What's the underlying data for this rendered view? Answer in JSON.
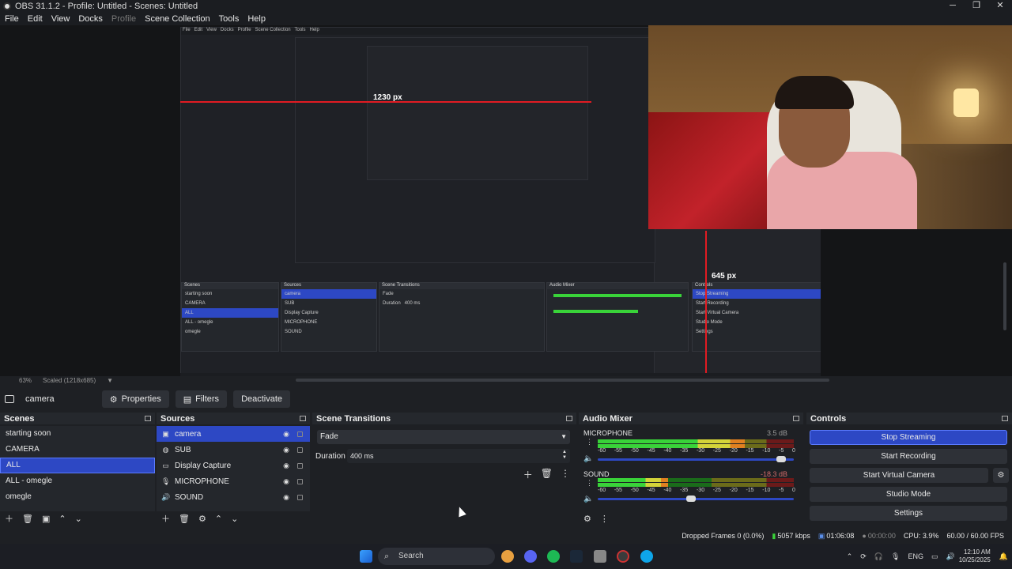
{
  "window": {
    "title": "OBS 31.1.2 - Profile: Untitled - Scenes: Untitled",
    "controls": [
      "─",
      "❐",
      "✕"
    ]
  },
  "menu": [
    "File",
    "Edit",
    "View",
    "Docks",
    "Profile",
    "Scene Collection",
    "Tools",
    "Help"
  ],
  "preview": {
    "measure_width": "1230 px",
    "measure_height": "645 px",
    "zoom": "63%",
    "scaled": "Scaled (1218x685)"
  },
  "context": {
    "source": "camera",
    "properties": "Properties",
    "filters": "Filters",
    "deactivate": "Deactivate"
  },
  "scenes": {
    "title": "Scenes",
    "items": [
      "starting soon",
      "CAMERA",
      "ALL",
      "ALL - omegle",
      "omegle"
    ],
    "selected": "ALL"
  },
  "sources": {
    "title": "Sources",
    "items": [
      {
        "name": "camera",
        "icon": "camera-icon"
      },
      {
        "name": "SUB",
        "icon": "browser-icon"
      },
      {
        "name": "Display Capture",
        "icon": "monitor-icon"
      },
      {
        "name": "MICROPHONE",
        "icon": "mic-icon"
      },
      {
        "name": "SOUND",
        "icon": "speaker-icon"
      }
    ]
  },
  "transitions": {
    "title": "Scene Transitions",
    "selected": "Fade",
    "duration_label": "Duration",
    "duration_value": "400 ms"
  },
  "mixer": {
    "title": "Audio Mixer",
    "scale": [
      "-60",
      "-55",
      "-50",
      "-45",
      "-40",
      "-35",
      "-30",
      "-25",
      "-20",
      "-15",
      "-10",
      "-5",
      "0"
    ],
    "channels": [
      {
        "name": "MICROPHONE",
        "db": "3.5 dB",
        "level": 0.75,
        "volume": 0.96
      },
      {
        "name": "SOUND",
        "db": "-18.3 dB",
        "level": 0.36,
        "volume": 0.5
      }
    ]
  },
  "controls": {
    "title": "Controls",
    "buttons": [
      "Stop Streaming",
      "Start Recording",
      "Start Virtual Camera",
      "Studio Mode",
      "Settings"
    ]
  },
  "status": {
    "dropped": "Dropped Frames 0 (0.0%)",
    "kbps": "5057 kbps",
    "stream_time": "01:06:08",
    "rec_time": "00:00:00",
    "cpu": "CPU: 3.9%",
    "fps": "60.00 / 60.00 FPS"
  },
  "taskbar": {
    "search": "Search",
    "lang": "ENG",
    "time": "12:10 AM",
    "date": "10/25/2025"
  },
  "colors": {
    "accent": "#2d48c4",
    "red": "#e11b22"
  }
}
